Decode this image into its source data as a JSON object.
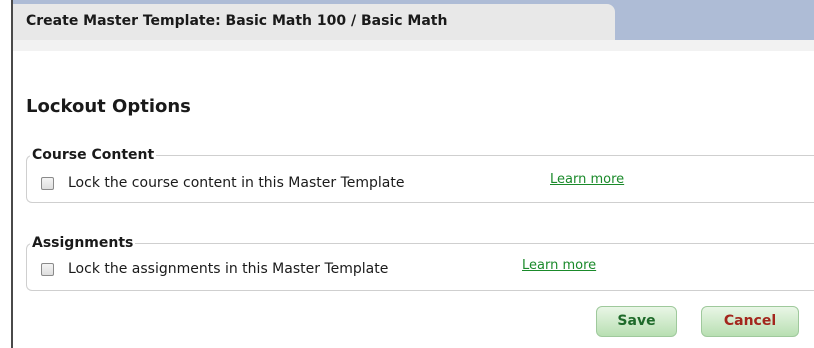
{
  "header": {
    "title": "Create Master Template: Basic Math 100 / Basic Math"
  },
  "main": {
    "heading": "Lockout Options",
    "groups": [
      {
        "legend": "Course Content",
        "checkbox_label": "Lock the course content in this Master Template",
        "checked": false,
        "link": "Learn more"
      },
      {
        "legend": "Assignments",
        "checkbox_label": "Lock the assignments in this Master Template",
        "checked": false,
        "link": "Learn more"
      }
    ]
  },
  "actions": {
    "save_label": "Save",
    "cancel_label": "Cancel"
  },
  "colors": {
    "tab_strip": "#aebcd6",
    "link": "#1a8a2a",
    "save_text": "#1e6a2a",
    "cancel_text": "#a3261d"
  }
}
